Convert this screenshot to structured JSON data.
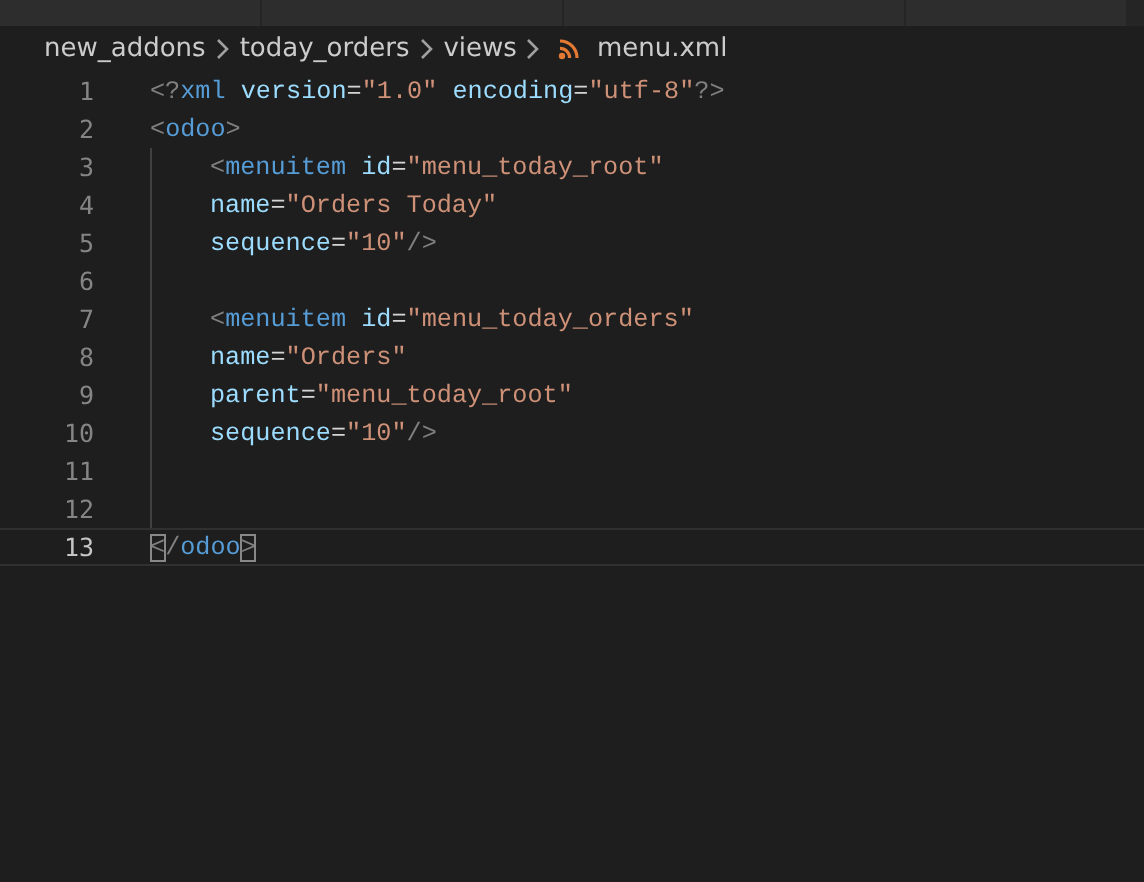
{
  "breadcrumbs": [
    {
      "label": "new_addons",
      "kind": "folder"
    },
    {
      "label": "today_orders",
      "kind": "folder"
    },
    {
      "label": "views",
      "kind": "folder"
    },
    {
      "label": "menu.xml",
      "kind": "file"
    }
  ],
  "code": [
    {
      "number": "1",
      "current": false,
      "tokens": [
        {
          "kind": "punct",
          "text": "<?"
        },
        {
          "kind": "tag",
          "text": "xml"
        },
        {
          "kind": "attr",
          "text": " version"
        },
        {
          "kind": "eq",
          "text": "="
        },
        {
          "kind": "string",
          "text": "\"1.0\""
        },
        {
          "kind": "attr",
          "text": " encoding"
        },
        {
          "kind": "eq",
          "text": "="
        },
        {
          "kind": "string",
          "text": "\"utf-8\""
        },
        {
          "kind": "punct",
          "text": "?>"
        }
      ]
    },
    {
      "number": "2",
      "current": false,
      "tokens": [
        {
          "kind": "punct",
          "text": "<"
        },
        {
          "kind": "tag",
          "text": "odoo"
        },
        {
          "kind": "punct",
          "text": ">"
        }
      ],
      "children": [
        {
          "number": "3",
          "current": false,
          "tokens": [
            {
              "kind": "punct",
              "text": "<"
            },
            {
              "kind": "tag",
              "text": "menuitem"
            },
            {
              "kind": "attr",
              "text": " id"
            },
            {
              "kind": "eq",
              "text": "="
            },
            {
              "kind": "string",
              "text": "\"menu_today_root\""
            }
          ]
        },
        {
          "number": "4",
          "current": false,
          "tokens": [
            {
              "kind": "attr",
              "text": "name"
            },
            {
              "kind": "eq",
              "text": "="
            },
            {
              "kind": "string",
              "text": "\"Orders Today\""
            }
          ]
        },
        {
          "number": "5",
          "current": false,
          "tokens": [
            {
              "kind": "attr",
              "text": "sequence"
            },
            {
              "kind": "eq",
              "text": "="
            },
            {
              "kind": "string",
              "text": "\"10\""
            },
            {
              "kind": "punct",
              "text": "/>"
            }
          ]
        },
        {
          "number": "6",
          "current": false
        },
        {
          "number": "7",
          "current": false,
          "tokens": [
            {
              "kind": "punct",
              "text": "<"
            },
            {
              "kind": "tag",
              "text": "menuitem"
            },
            {
              "kind": "attr",
              "text": " id"
            },
            {
              "kind": "eq",
              "text": "="
            },
            {
              "kind": "string",
              "text": "\"menu_today_orders\""
            }
          ]
        },
        {
          "number": "8",
          "current": false,
          "tokens": [
            {
              "kind": "attr",
              "text": "name"
            },
            {
              "kind": "eq",
              "text": "="
            },
            {
              "kind": "string",
              "text": "\"Orders\""
            }
          ]
        },
        {
          "number": "9",
          "current": false,
          "tokens": [
            {
              "kind": "attr",
              "text": "parent"
            },
            {
              "kind": "eq",
              "text": "="
            },
            {
              "kind": "string",
              "text": "\"menu_today_root\""
            }
          ]
        },
        {
          "number": "10",
          "current": false,
          "tokens": [
            {
              "kind": "attr",
              "text": "sequence"
            },
            {
              "kind": "eq",
              "text": "="
            },
            {
              "kind": "string",
              "text": "\"10\""
            },
            {
              "kind": "punct",
              "text": "/>"
            }
          ]
        },
        {
          "number": "11",
          "current": false
        },
        {
          "number": "12",
          "current": false
        }
      ]
    },
    {
      "number": "13",
      "current": true,
      "tokens": [
        {
          "kind": "punct",
          "text": "<",
          "matched": true
        },
        {
          "kind": "punct",
          "text": "/"
        },
        {
          "kind": "tag",
          "text": "odoo"
        },
        {
          "kind": "punct",
          "text": ">",
          "matched": true
        }
      ]
    }
  ]
}
